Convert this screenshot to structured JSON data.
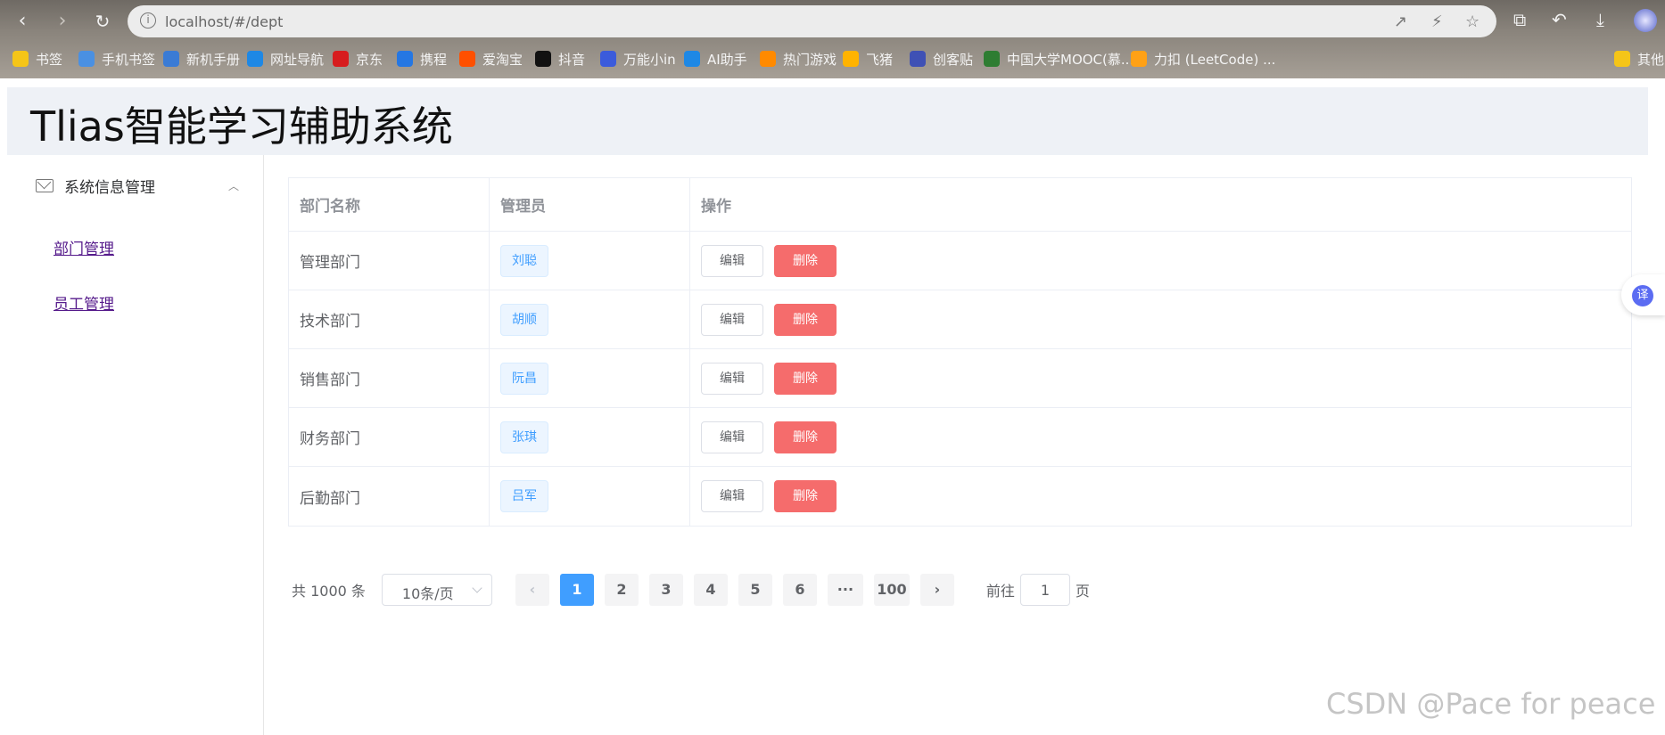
{
  "browser": {
    "url": "localhost/#/dept",
    "bookmarks": [
      {
        "label": "书签",
        "icon": "star-icon",
        "color": "#f5c518"
      },
      {
        "label": "手机书签",
        "icon": "phone-icon",
        "color": "#4a90e2"
      },
      {
        "label": "新机手册",
        "icon": "book-icon",
        "color": "#3a7bd5"
      },
      {
        "label": "网址导航",
        "icon": "ie-icon",
        "color": "#1e88e5"
      },
      {
        "label": "京东",
        "icon": "jd-icon",
        "color": "#d71c1e"
      },
      {
        "label": "携程",
        "icon": "ctrip-icon",
        "color": "#2577e3"
      },
      {
        "label": "爱淘宝",
        "icon": "taobao-icon",
        "color": "#ff5000"
      },
      {
        "label": "抖音",
        "icon": "douyin-icon",
        "color": "#111111"
      },
      {
        "label": "万能小in",
        "icon": "robot-icon",
        "color": "#3b5bdb"
      },
      {
        "label": "AI助手",
        "icon": "ai-icon",
        "color": "#1e88e5"
      },
      {
        "label": "热门游戏",
        "icon": "game-icon",
        "color": "#ff8a00"
      },
      {
        "label": "飞猪",
        "icon": "fliggy-icon",
        "color": "#ffb300"
      },
      {
        "label": "创客贴",
        "icon": "chuangke-icon",
        "color": "#3f51b5"
      },
      {
        "label": "中国大学MOOC(慕...",
        "icon": "mooc-icon",
        "color": "#2e7d32"
      },
      {
        "label": "力扣 (LeetCode) ...",
        "icon": "leetcode-icon",
        "color": "#ffa116"
      },
      {
        "label": "其他",
        "icon": "folder-icon",
        "color": "#f5c518"
      }
    ]
  },
  "header": {
    "title": "Tlias智能学习辅助系统"
  },
  "sidebar": {
    "group_label": "系统信息管理",
    "items": [
      {
        "label": "部门管理"
      },
      {
        "label": "员工管理"
      }
    ]
  },
  "table": {
    "columns": [
      "部门名称",
      "管理员",
      "操作"
    ],
    "rows": [
      {
        "name": "管理部门",
        "manager": "刘聪"
      },
      {
        "name": "技术部门",
        "manager": "胡顺"
      },
      {
        "name": "销售部门",
        "manager": "阮昌"
      },
      {
        "name": "财务部门",
        "manager": "张琪"
      },
      {
        "name": "后勤部门",
        "manager": "吕军"
      }
    ],
    "edit_label": "编辑",
    "delete_label": "删除"
  },
  "pagination": {
    "total_text": "共 1000 条",
    "page_size": "10条/页",
    "pages": [
      "1",
      "2",
      "3",
      "4",
      "5",
      "6",
      "···",
      "100"
    ],
    "current": "1",
    "goto_prefix": "前往",
    "goto_value": "1",
    "goto_suffix": "页"
  },
  "translate_label": "译",
  "watermark": "CSDN @Pace for peace",
  "colors": {
    "primary": "#409eff",
    "danger": "#f56c6c",
    "header_bg": "#eef1f6"
  }
}
